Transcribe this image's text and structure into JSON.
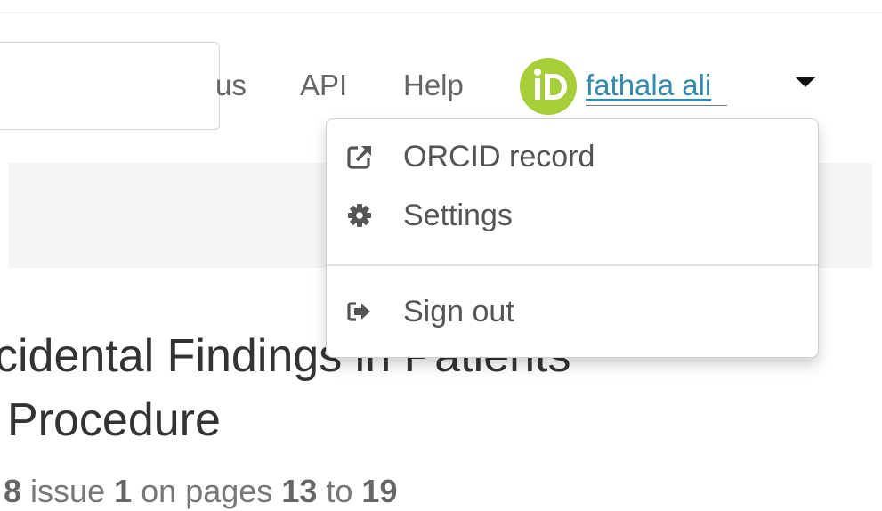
{
  "nav": {
    "partial_link": "us",
    "api": "API",
    "help": "Help"
  },
  "user": {
    "logo_text": "iD",
    "name": "fathala ali"
  },
  "dropdown": {
    "items": [
      {
        "label": "ORCID record",
        "icon": "external-link-icon"
      },
      {
        "label": "Settings",
        "icon": "gear-icon"
      },
      {
        "label": "Sign out",
        "icon": "sign-out-icon"
      }
    ]
  },
  "article": {
    "title_line_1": "cidental Findings in Patients",
    "title_line_2": "Procedure",
    "volume": "8",
    "issue_word": "issue",
    "issue_number": "1",
    "pages_word": "on pages",
    "page_start": "13",
    "to_word": "to",
    "page_end": "19"
  },
  "colors": {
    "orcid_green": "#a6ce39",
    "link_blue": "#338caf",
    "text_gray": "#555555"
  }
}
